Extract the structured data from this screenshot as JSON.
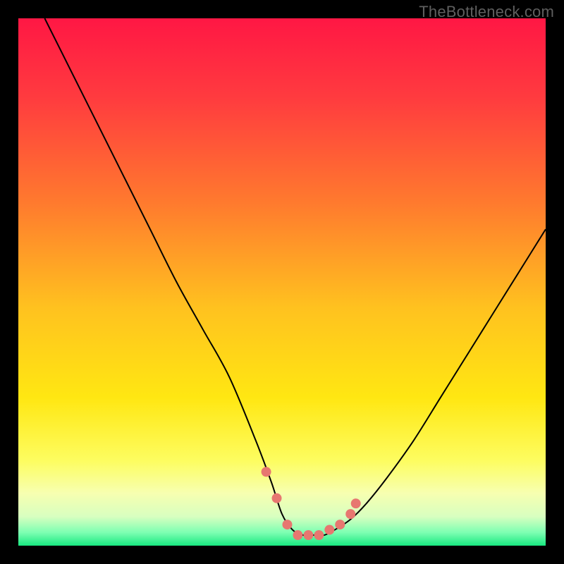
{
  "watermark": "TheBottleneck.com",
  "colors": {
    "frame": "#000000",
    "curve": "#000000",
    "marker": "#e77770",
    "gradient_stops": [
      {
        "offset": 0.0,
        "color": "#ff1744"
      },
      {
        "offset": 0.15,
        "color": "#ff3b3f"
      },
      {
        "offset": 0.35,
        "color": "#ff7a2e"
      },
      {
        "offset": 0.55,
        "color": "#ffc21f"
      },
      {
        "offset": 0.72,
        "color": "#ffe712"
      },
      {
        "offset": 0.84,
        "color": "#fdfd61"
      },
      {
        "offset": 0.9,
        "color": "#f7ffb0"
      },
      {
        "offset": 0.945,
        "color": "#d8ffc0"
      },
      {
        "offset": 0.975,
        "color": "#7dffb2"
      },
      {
        "offset": 1.0,
        "color": "#18e880"
      }
    ]
  },
  "chart_data": {
    "type": "line",
    "title": "",
    "xlabel": "",
    "ylabel": "",
    "xlim": [
      0,
      100
    ],
    "ylim": [
      0,
      100
    ],
    "grid": false,
    "legend": false,
    "series": [
      {
        "name": "bottleneck-curve",
        "x": [
          5,
          10,
          15,
          20,
          25,
          30,
          35,
          40,
          45,
          48,
          50,
          52,
          54,
          56,
          58,
          60,
          63,
          66,
          70,
          75,
          80,
          85,
          90,
          95,
          100
        ],
        "values": [
          100,
          90,
          80,
          70,
          60,
          50,
          41,
          32,
          20,
          12,
          6,
          3,
          2,
          2,
          2,
          3,
          5,
          8,
          13,
          20,
          28,
          36,
          44,
          52,
          60
        ]
      }
    ],
    "markers": {
      "name": "highlight-points",
      "x": [
        47,
        49,
        51,
        53,
        55,
        57,
        59,
        61,
        63,
        64
      ],
      "values": [
        14,
        9,
        4,
        2,
        2,
        2,
        3,
        4,
        6,
        8
      ]
    }
  }
}
